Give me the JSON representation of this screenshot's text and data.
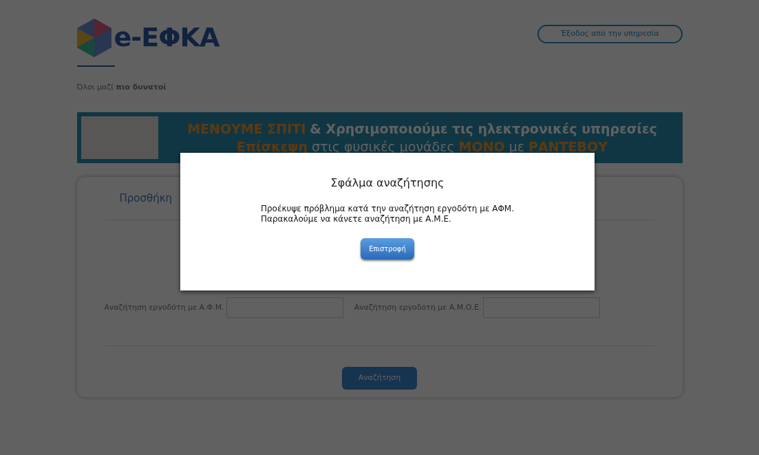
{
  "header": {
    "logo_text": "e-ΕΦΚΑ",
    "tagline": "Όλοι μαζί **πιο δυνατοί**",
    "exit_button": "Έξοδος από την υπηρεσία"
  },
  "banner": {
    "lines": [
      [
        {
          "text": "ΜΕΝΟΥΜΕ ΣΠΙΤΙ",
          "kind": "highlight"
        },
        {
          "text": "& Χρησιμοποιούμε τις ηλεκτρονικές υπηρεσίες",
          "kind": "plain"
        }
      ],
      [
        {
          "text": "Επίσκεψη",
          "kind": "highlight"
        },
        {
          "text": "στις φυσικές μονάδες",
          "kind": "plain"
        },
        {
          "text": "ΜΟΝΟ",
          "kind": "highlight"
        },
        {
          "text": "με",
          "kind": "plain"
        },
        {
          "text": "ΡΑΝΤΕΒΟΥ",
          "kind": "highlight"
        }
      ]
    ]
  },
  "form": {
    "title": "Προσθήκη",
    "fields": [
      {
        "label": "Αναζήτηση εργοδότη με Α.Φ.Μ."
      },
      {
        "label": "Αναζήτηση εργοδότη με Α.Μ.Ο.Ε."
      }
    ],
    "search_button": "Αναζήτηση"
  },
  "dialog": {
    "title": "Σφάλμα αναζήτησης",
    "message": [
      "Προέκυψε πρόβλημα κατά την αναζήτηση εργοδότη με ΑΦΜ.",
      "Παρακαλούμε να κάνετε αναζήτηση με Α.Μ.Ε."
    ],
    "button": "Επιστροφή"
  }
}
